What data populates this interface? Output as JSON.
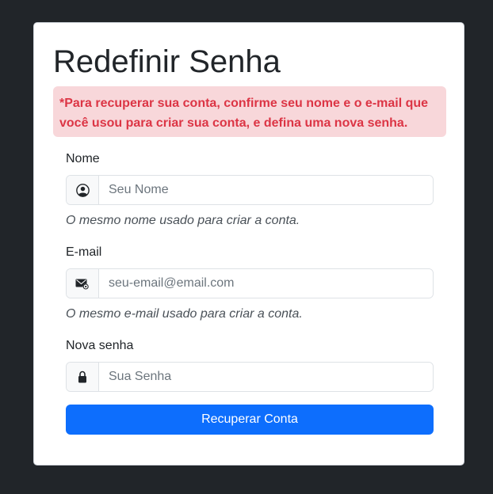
{
  "page": {
    "title": "Redefinir Senha",
    "alert": "*Para recuperar sua conta, confirme seu nome e o e-mail que você usou para criar sua conta, e defina uma nova senha."
  },
  "form": {
    "name": {
      "label": "Nome",
      "icon": "person-circle-icon",
      "placeholder": "Seu Nome",
      "help": "O mesmo nome usado para criar a conta."
    },
    "email": {
      "label": "E-mail",
      "icon": "envelope-at-icon",
      "placeholder": "seu-email@email.com",
      "help": "O mesmo e-mail usado para criar a conta."
    },
    "password": {
      "label": "Nova senha",
      "icon": "lock-icon",
      "placeholder": "Sua Senha"
    },
    "submit_label": "Recuperar Conta"
  },
  "colors": {
    "background": "#212529",
    "alert_bg": "#f8d7da",
    "alert_text": "#dc3545",
    "primary": "#0d6efd"
  }
}
